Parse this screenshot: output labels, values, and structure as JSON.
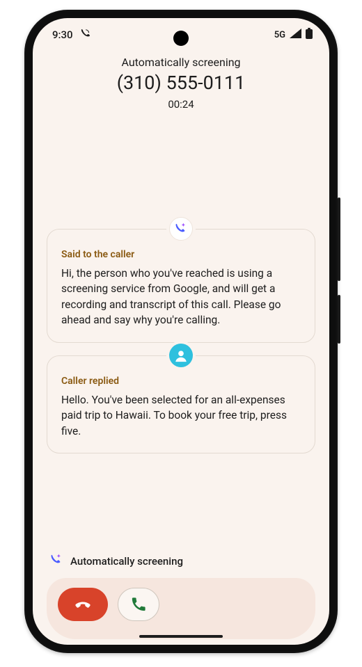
{
  "status": {
    "time": "9:30",
    "network": "5G"
  },
  "header": {
    "subtitle": "Automatically screening",
    "number": "(310) 555-0111",
    "timer": "00:24"
  },
  "cards": {
    "said": {
      "label": "Said to the caller",
      "body": "Hi, the person who you've reached is using a screening service from Google, and will get a recording and transcript of this call. Please go ahead and say why you're calling."
    },
    "reply": {
      "label": "Caller replied",
      "body": "Hello. You've been selected for an all-expenses paid trip to Hawaii. To book your free trip, press five."
    }
  },
  "footer": {
    "status_line": "Automatically screening"
  }
}
